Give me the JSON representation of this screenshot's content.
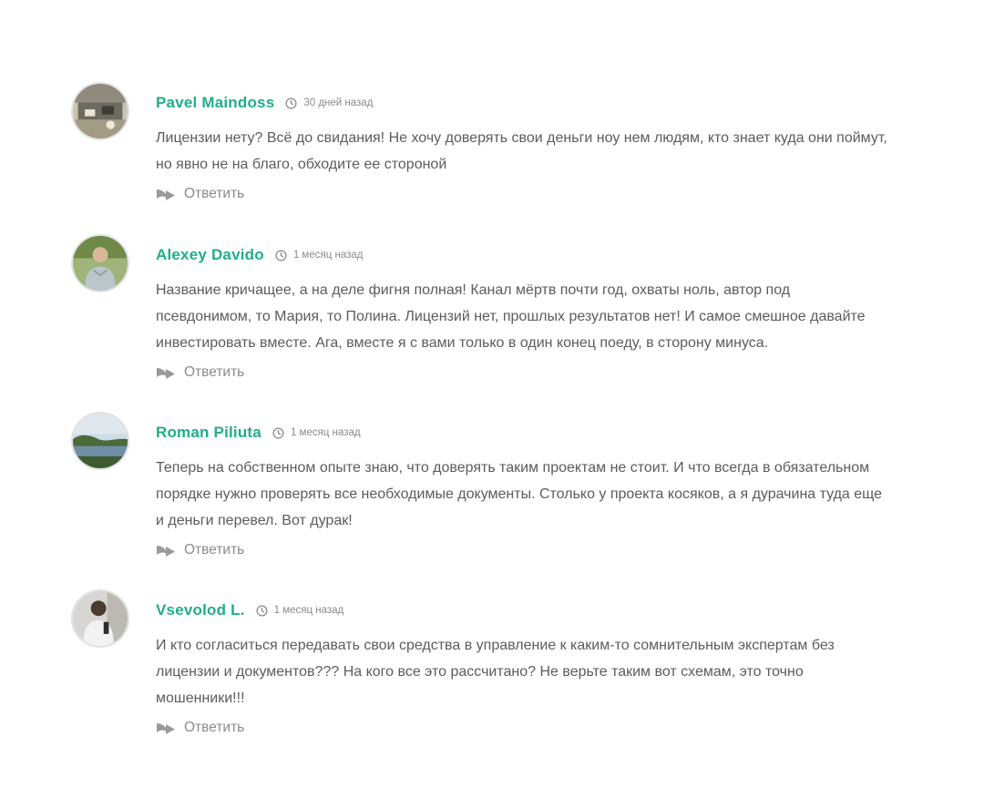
{
  "colors": {
    "accent": "#1fae8b",
    "text": "#5c5c5c",
    "muted": "#8b8b8b"
  },
  "comments": [
    {
      "author": "Pavel Maindoss",
      "date": "30 дней назад",
      "text": "Лицензии нету? Всё до свидания! Не хочу доверять свои деньги ноу нем людям, кто знает куда они поймут, но явно не на благо, обходите ее стороной",
      "reply_label": "Ответить",
      "avatar_icon": "avatar-photo"
    },
    {
      "author": "Alexey Davido",
      "date": "1 месяц назад",
      "text": "Название кричащее, а на деле фигня полная! Канал мёртв почти год, охваты ноль, автор под псевдонимом, то Мария, то Полина. Лицензий нет, прошлых результатов нет! И самое смешное давайте инвестировать вместе. Ага, вместе я с вами только в один конец поеду, в сторону минуса.",
      "reply_label": "Ответить",
      "avatar_icon": "avatar-photo"
    },
    {
      "author": "Roman Piliuta",
      "date": "1 месяц назад",
      "text": "Теперь на собственном опыте знаю, что доверять таким проектам не стоит. И что всегда в обязательном порядке нужно проверять все необходимые документы. Столько у проекта косяков, а я дурачина туда еще и деньги перевел. Вот дурак!",
      "reply_label": "Ответить",
      "avatar_icon": "avatar-photo"
    },
    {
      "author": "Vsevolod L.",
      "date": "1 месяц назад",
      "text": "И кто согласиться передавать свои средства в управление к каким-то сомнительным экспертам без лицензии и документов??? На кого все это рассчитано? Не верьте таким вот схемам, это точно мошенники!!!",
      "reply_label": "Ответить",
      "avatar_icon": "avatar-photo"
    }
  ]
}
